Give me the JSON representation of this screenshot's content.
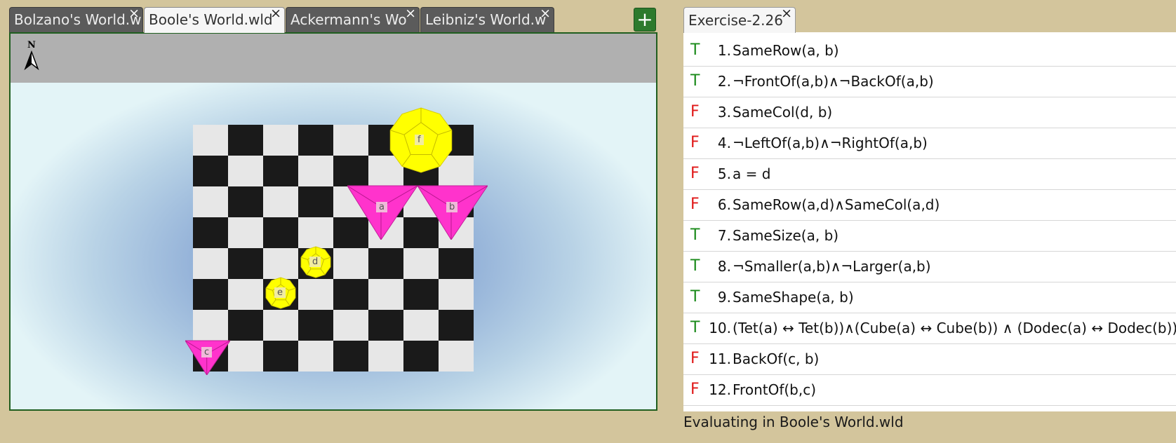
{
  "world_tabs": [
    {
      "label": "Bolzano's World.wld",
      "active": false
    },
    {
      "label": "Boole's World.wld",
      "active": true
    },
    {
      "label": "Ackermann's Wo",
      "active": false
    },
    {
      "label": "Leibniz's World.w",
      "active": false
    }
  ],
  "close_glyph": "×",
  "add_label": "+",
  "compass": {
    "letter": "N",
    "icon": "north-arrow-icon"
  },
  "board": {
    "columns": 8,
    "rows": 8
  },
  "objects": [
    {
      "name": "a",
      "shape": "tet",
      "size": "large",
      "color": "magenta",
      "col": 5,
      "row": 2
    },
    {
      "name": "b",
      "shape": "tet",
      "size": "large",
      "color": "magenta",
      "col": 7,
      "row": 2
    },
    {
      "name": "c",
      "shape": "tet",
      "size": "small",
      "color": "magenta",
      "col": 0,
      "row": 7
    },
    {
      "name": "d",
      "shape": "dodec",
      "size": "small",
      "color": "yellow",
      "col": 3,
      "row": 4
    },
    {
      "name": "e",
      "shape": "dodec",
      "size": "small",
      "color": "yellow",
      "col": 2,
      "row": 5
    },
    {
      "name": "f",
      "shape": "dodec",
      "size": "large",
      "color": "yellow",
      "col": 6,
      "row": 0
    }
  ],
  "colors": {
    "magenta": "#ff33cc",
    "yellow": "#ffff00",
    "true": "#1a8a1a",
    "false": "#e01818"
  },
  "exercise_tab": {
    "label": "Exercise-2.26"
  },
  "sentences": [
    {
      "value": "T",
      "num": "1.",
      "formula": "SameRow(a, b)"
    },
    {
      "value": "T",
      "num": "2.",
      "formula": "¬FrontOf(a,b)∧¬BackOf(a,b)"
    },
    {
      "value": "F",
      "num": "3.",
      "formula": "SameCol(d, b)"
    },
    {
      "value": "F",
      "num": "4.",
      "formula": "¬LeftOf(a,b)∧¬RightOf(a,b)"
    },
    {
      "value": "F",
      "num": "5.",
      "formula": "a = d"
    },
    {
      "value": "F",
      "num": "6.",
      "formula": "SameRow(a,d)∧SameCol(a,d)"
    },
    {
      "value": "T",
      "num": "7.",
      "formula": "SameSize(a, b)"
    },
    {
      "value": "T",
      "num": "8.",
      "formula": "¬Smaller(a,b)∧¬Larger(a,b)"
    },
    {
      "value": "T",
      "num": "9.",
      "formula": "SameShape(a, b)"
    },
    {
      "value": "T",
      "num": "10.",
      "formula": "(Tet(a) ↔ Tet(b))∧(Cube(a) ↔ Cube(b)) ∧ (Dodec(a) ↔ Dodec(b))"
    },
    {
      "value": "F",
      "num": "11.",
      "formula": "BackOf(c, b)"
    },
    {
      "value": "F",
      "num": "12.",
      "formula": "FrontOf(b,c)"
    }
  ],
  "status": "Evaluating in Boole's World.wld"
}
